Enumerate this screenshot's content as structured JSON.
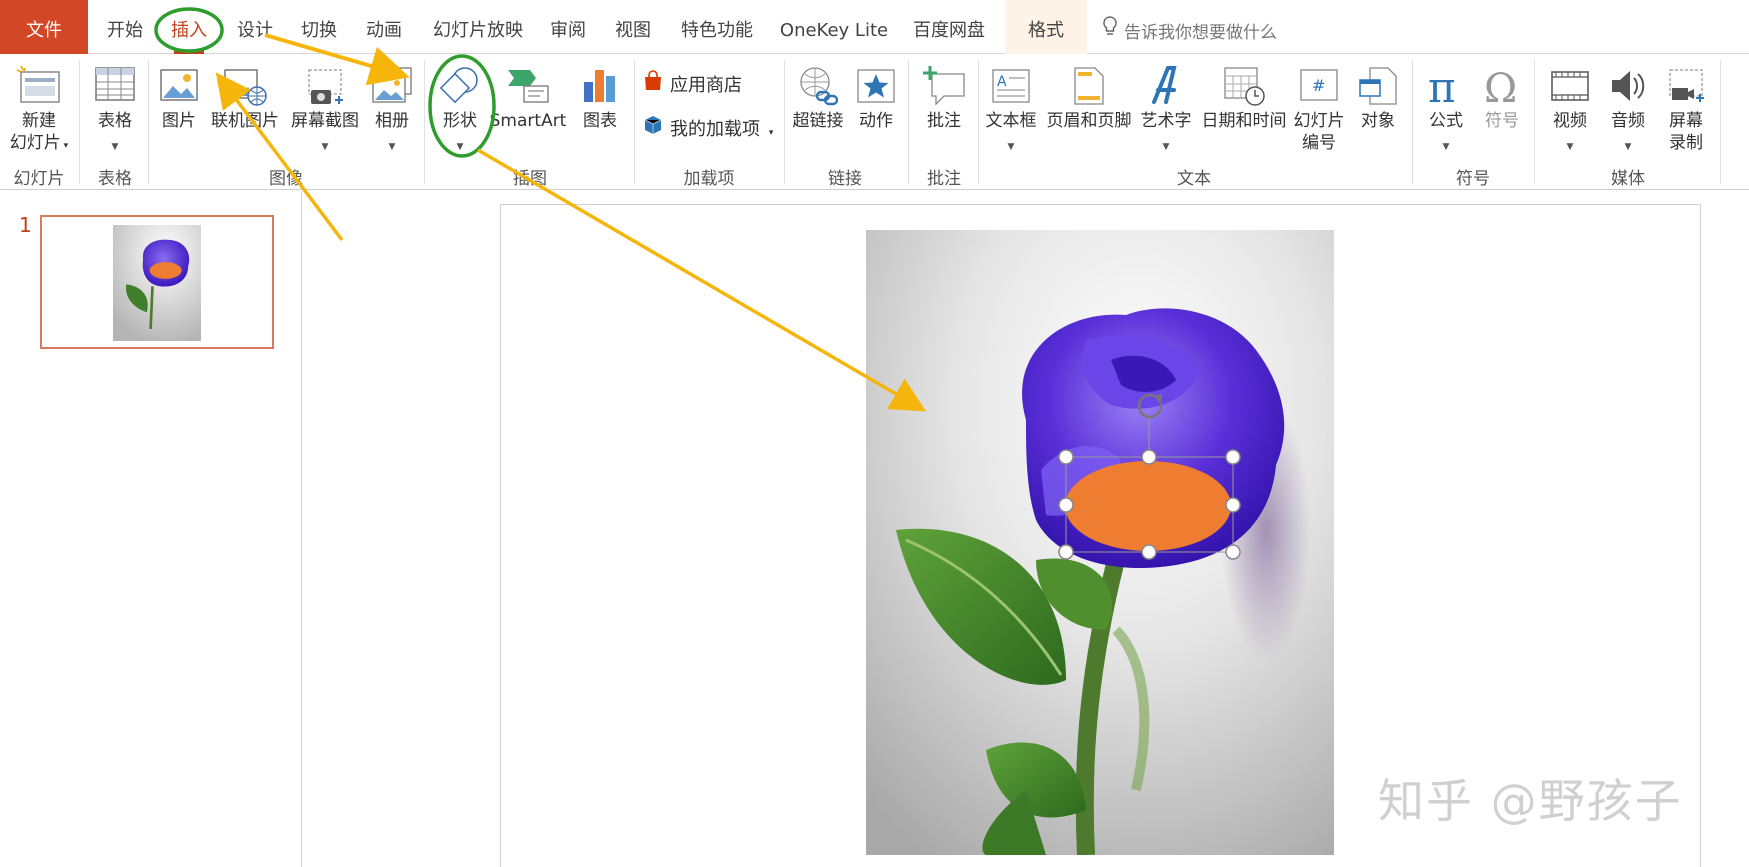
{
  "tabs": [
    {
      "label": "文件",
      "key": "file"
    },
    {
      "label": "开始",
      "key": "home"
    },
    {
      "label": "插入",
      "key": "insert",
      "active": true
    },
    {
      "label": "设计",
      "key": "design"
    },
    {
      "label": "切换",
      "key": "transitions"
    },
    {
      "label": "动画",
      "key": "animations"
    },
    {
      "label": "幻灯片放映",
      "key": "slideshow"
    },
    {
      "label": "审阅",
      "key": "review"
    },
    {
      "label": "视图",
      "key": "view"
    },
    {
      "label": "特色功能",
      "key": "features"
    },
    {
      "label": "OneKey Lite",
      "key": "onekey"
    },
    {
      "label": "百度网盘",
      "key": "baidu"
    },
    {
      "label": "格式",
      "key": "format"
    }
  ],
  "tell_me": "告诉我你想要做什么",
  "ribbon": {
    "slides": {
      "new_slide_1": "新建",
      "new_slide_2": "幻灯片",
      "group": "幻灯片"
    },
    "tables": {
      "table": "表格",
      "group": "表格"
    },
    "images": {
      "picture": "图片",
      "online_picture": "联机图片",
      "screenshot": "屏幕截图",
      "album": "相册",
      "group": "图像"
    },
    "illustrations": {
      "shapes": "形状",
      "smartart": "SmartArt",
      "chart": "图表",
      "group": "插图"
    },
    "addins": {
      "store": "应用商店",
      "my_addins": "我的加载项",
      "group": "加载项"
    },
    "links": {
      "hyperlink": "超链接",
      "action": "动作",
      "group": "链接"
    },
    "comments": {
      "comment": "批注",
      "group": "批注"
    },
    "text": {
      "textbox": "文本框",
      "header_footer": "页眉和页脚",
      "wordart": "艺术字",
      "datetime": "日期和时间",
      "slide_number_1": "幻灯片",
      "slide_number_2": "编号",
      "object": "对象",
      "group": "文本"
    },
    "symbols": {
      "equation": "公式",
      "symbol": "符号",
      "group": "符号"
    },
    "media": {
      "video": "视频",
      "audio": "音频",
      "screen_rec_1": "屏幕",
      "screen_rec_2": "录制",
      "group": "媒体"
    }
  },
  "slide_panel": {
    "slide_number": "1"
  },
  "watermark": "知乎 @野孩子",
  "colors": {
    "file_tab": "#d24726",
    "active_tab_text": "#c43e1c",
    "annotation_circle": "#2e9d2e",
    "annotation_arrow": "#f5b50a",
    "ellipse_fill": "#ee7d31",
    "rose": "#5a2fd8"
  },
  "icons": [
    "new-slide-icon",
    "table-icon",
    "picture-icon",
    "online-picture-icon",
    "screenshot-icon",
    "album-icon",
    "shapes-icon",
    "smartart-icon",
    "chart-icon",
    "store-icon",
    "addins-icon",
    "hyperlink-icon",
    "action-icon",
    "comment-icon",
    "textbox-icon",
    "header-footer-icon",
    "wordart-icon",
    "datetime-icon",
    "slide-number-icon",
    "object-icon",
    "equation-icon",
    "symbol-icon",
    "video-icon",
    "audio-icon",
    "screen-record-icon",
    "lightbulb-icon"
  ]
}
